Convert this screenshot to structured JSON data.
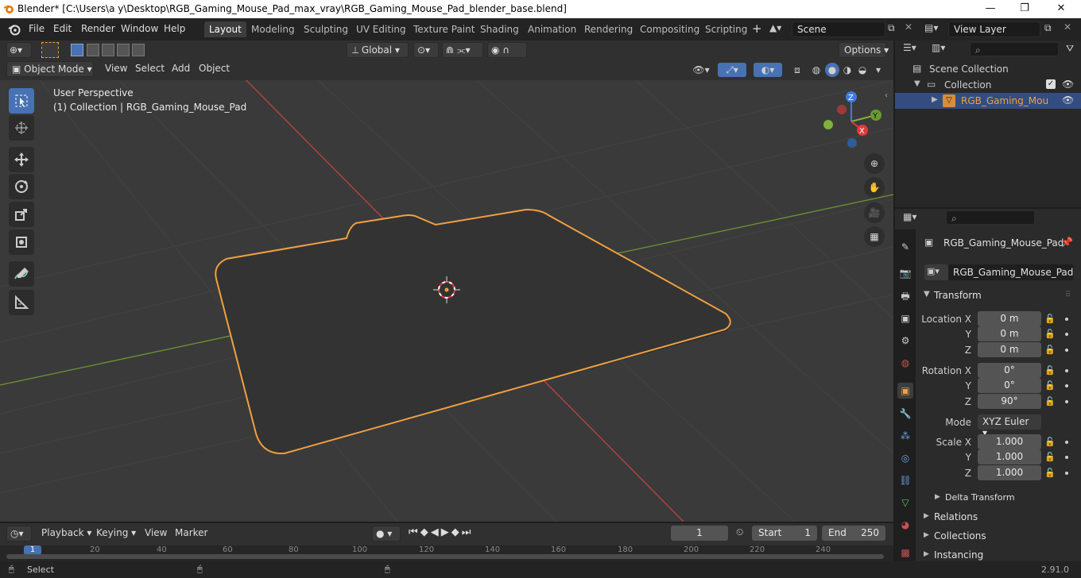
{
  "window": {
    "title": "Blender* [C:\\Users\\a y\\Desktop\\RGB_Gaming_Mouse_Pad_max_vray\\RGB_Gaming_Mouse_Pad_blender_base.blend]",
    "minimize": "—",
    "maximize": "❐",
    "close": "✕"
  },
  "menu": {
    "file": "File",
    "edit": "Edit",
    "render": "Render",
    "window": "Window",
    "help": "Help"
  },
  "workspaces": [
    "Layout",
    "Modeling",
    "Sculpting",
    "UV Editing",
    "Texture Paint",
    "Shading",
    "Animation",
    "Rendering",
    "Compositing",
    "Scripting"
  ],
  "scene": {
    "name": "Scene",
    "view_layer": "View Layer"
  },
  "tool_header": {
    "orientation": "Global",
    "options": "Options"
  },
  "viewport_header": {
    "mode": "Object Mode",
    "view": "View",
    "select": "Select",
    "add": "Add",
    "object": "Object"
  },
  "viewport": {
    "perspective": "User Perspective",
    "collection_info": "(1) Collection | RGB_Gaming_Mouse_Pad",
    "gizmo": {
      "z": "Z",
      "y": "Y",
      "x": "X"
    }
  },
  "outliner": {
    "scene_collection": "Scene Collection",
    "collection": "Collection",
    "object": "RGB_Gaming_Mouse"
  },
  "properties": {
    "object_name": "RGB_Gaming_Mouse_Pad",
    "datablock": "RGB_Gaming_Mouse_Pad",
    "transform_title": "Transform",
    "location_label": "Location X",
    "rotation_label": "Rotation X",
    "scale_label": "Scale X",
    "y_label": "Y",
    "z_label": "Z",
    "location": {
      "x": "0 m",
      "y": "0 m",
      "z": "0 m"
    },
    "rotation": {
      "x": "0°",
      "y": "0°",
      "z": "90°"
    },
    "mode_label": "Mode",
    "mode_value": "XYZ Euler",
    "scale": {
      "x": "1.000",
      "y": "1.000",
      "z": "1.000"
    },
    "delta_transform": "Delta Transform",
    "relations": "Relations",
    "collections": "Collections",
    "instancing": "Instancing"
  },
  "timeline": {
    "playback": "Playback",
    "keying": "Keying",
    "view": "View",
    "marker": "Marker",
    "current_frame": "1",
    "start_label": "Start",
    "start": "1",
    "end_label": "End",
    "end": "250",
    "ruler": [
      "1",
      "20",
      "40",
      "60",
      "80",
      "100",
      "120",
      "140",
      "160",
      "180",
      "200",
      "220",
      "240"
    ]
  },
  "status": {
    "select": "Select",
    "version": "2.91.0"
  },
  "colors": {
    "accent": "#4772b3",
    "selection": "#f0a040",
    "axis_x": "#e03a3a",
    "axis_y": "#7fb13c",
    "axis_z": "#3a7de0"
  }
}
